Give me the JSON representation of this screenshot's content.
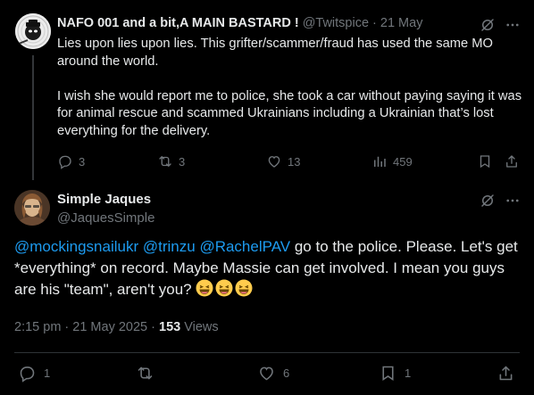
{
  "parent_tweet": {
    "display_name": "NAFO 001 and a bit,A MAIN BASTARD !",
    "handle": "@Twitspice",
    "separator": "·",
    "date": "21 May",
    "text_p1": "Lies upon lies upon lies. This grifter/scammer/fraud has used the same MO around the world.",
    "text_p2": "I wish she would report me to police, she took a car without paying saying it was for animal rescue and scammed Ukrainians including a Ukrainian that’s lost everything for the delivery.",
    "actions": {
      "replies": "3",
      "reposts": "3",
      "likes": "13",
      "views": "459"
    }
  },
  "main_tweet": {
    "display_name": "Simple Jaques",
    "handle": "@JaquesSimple",
    "mention1": "@mockingsnailukr",
    "mention2": "@trinzu",
    "mention3": "@RachelPAV",
    "text": " go to the police. Please. Let's get *everything* on record. Maybe Massie can get involved. I mean you guys are his \"team\", aren't you? ",
    "emoji_count": 3,
    "time": "2:15 pm · 21 May 2025 · ",
    "views_count": "153",
    "views_label": " Views",
    "actions": {
      "replies": "1",
      "likes": "6",
      "bookmarks": "1"
    }
  },
  "colors": {
    "background": "#000000",
    "text": "#e7e9ea",
    "muted": "#71767b",
    "link": "#1d9bf0",
    "divider": "#2f3336"
  }
}
